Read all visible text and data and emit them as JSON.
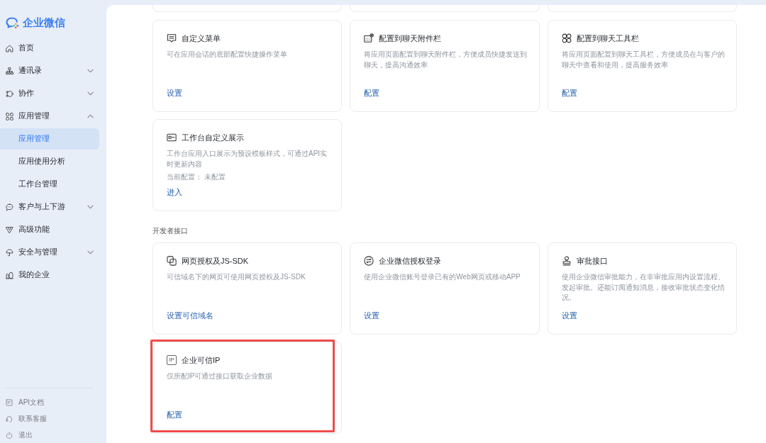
{
  "sidebar": {
    "logo": "企业微信",
    "items": [
      {
        "label": "首页",
        "selected": false
      },
      {
        "label": "通讯录",
        "selected": false,
        "expanded": false
      },
      {
        "label": "协作",
        "selected": false,
        "expanded": false
      },
      {
        "label": "应用管理",
        "selected": false,
        "expanded": true,
        "children": [
          {
            "label": "应用管理",
            "selected": true
          },
          {
            "label": "应用使用分析",
            "selected": false
          },
          {
            "label": "工作台管理",
            "selected": false
          }
        ]
      },
      {
        "label": "客户与上下游",
        "selected": false,
        "expanded": false
      },
      {
        "label": "高级功能",
        "selected": false
      },
      {
        "label": "安全与管理",
        "selected": false,
        "expanded": false
      },
      {
        "label": "我的企业",
        "selected": false
      }
    ],
    "footer": [
      {
        "label": "API文档"
      },
      {
        "label": "联系客服"
      },
      {
        "label": "退出"
      }
    ]
  },
  "content": {
    "sections": [
      {
        "cards": [
          {
            "title": "自定义菜单",
            "description": "可在应用会话的底部配置快捷操作菜单",
            "link": "设置",
            "highlighted": false
          },
          {
            "title": "配置到聊天附件栏",
            "description": "将应用页面配置到聊天附件栏，方便成员快捷发送到聊天，提高沟通效率",
            "link": "配置",
            "highlighted": false
          },
          {
            "title": "配置到聊天工具栏",
            "description": "将应用页面配置到聊天工具栏，方便成员在与客户的聊天中查看和使用，提高服务效率",
            "link": "配置",
            "highlighted": false
          },
          {
            "title": "工作台自定义展示",
            "description": "工作台应用入口展示为预设模板样式，可通过API实时更新内容",
            "status": "当前配置： 未配置",
            "link": "进入",
            "highlighted": false
          }
        ]
      },
      {
        "heading": "开发者接口",
        "cards": [
          {
            "title": "网页授权及JS-SDK",
            "description": "可信域名下的网页可使用网页授权及JS-SDK",
            "link": "设置可信域名",
            "highlighted": false
          },
          {
            "title": "企业微信授权登录",
            "description": "使用企业微信账号登录已有的Web网页或移动APP",
            "link": "设置",
            "highlighted": false
          },
          {
            "title": "审批接口",
            "description": "使用企业微信审批能力，在非审批应用内设置流程、发起审批。还能订阅通知消息，接收审批状态变化情况。",
            "link": "设置",
            "highlighted": false
          },
          {
            "title": "企业可信IP",
            "icon_text": "IP",
            "description": "仅所配IP可通过接口获取企业数据",
            "link": "配置",
            "highlighted": true
          }
        ]
      }
    ]
  }
}
